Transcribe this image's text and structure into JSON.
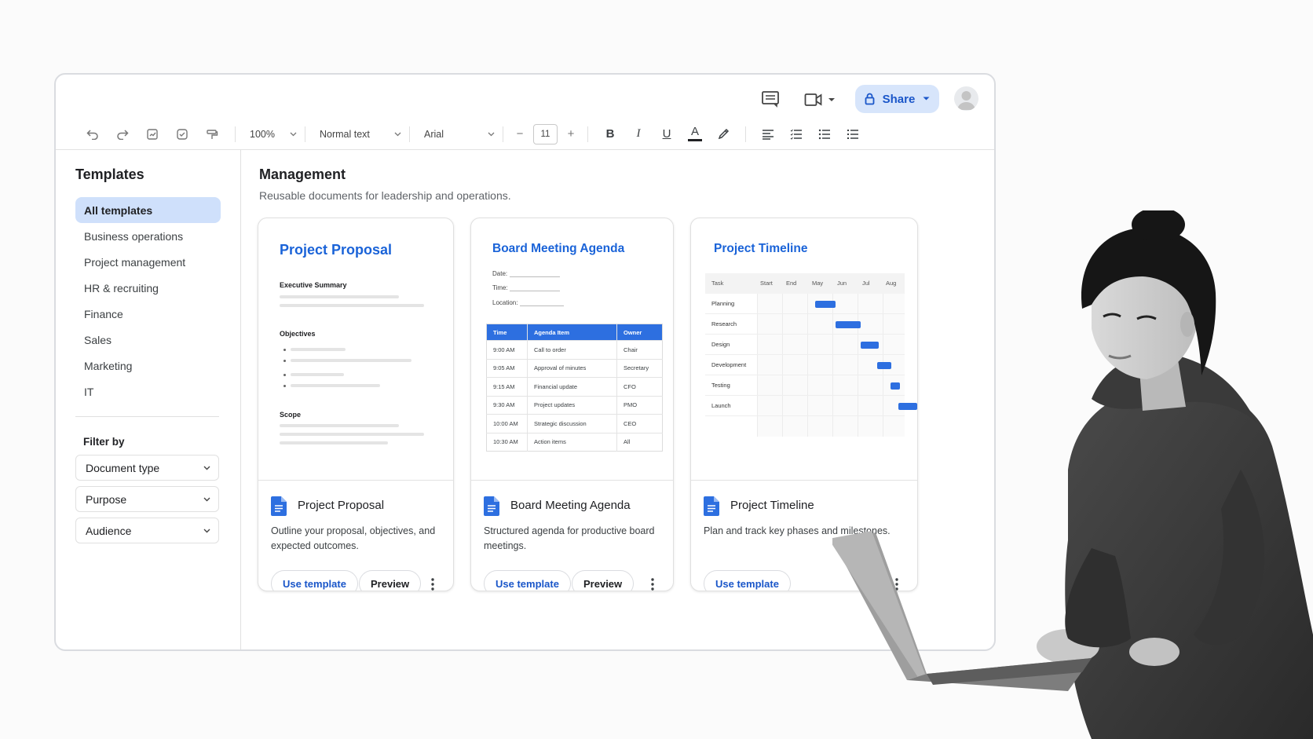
{
  "toolbar": {
    "zoom": "100%",
    "style": "Normal text",
    "font": "Arial",
    "font_size": "11",
    "minus": "−",
    "plus": "+",
    "bold": "B",
    "italic": "I",
    "underline": "U",
    "text_color": "A"
  },
  "header": {
    "share_label": "Share"
  },
  "sidebar": {
    "title": "Templates",
    "items": [
      {
        "label": "All templates",
        "active": true
      },
      {
        "label": "Business operations"
      },
      {
        "label": "Project management"
      },
      {
        "label": "HR & recruiting"
      },
      {
        "label": "Finance"
      },
      {
        "label": "Sales"
      },
      {
        "label": "Marketing"
      },
      {
        "label": "IT"
      }
    ],
    "filter_title": "Filter by",
    "filters": [
      "Document type",
      "Purpose",
      "Audience"
    ]
  },
  "main": {
    "title": "Management",
    "subtitle": "Reusable documents for leadership and operations."
  },
  "cards": [
    {
      "preview_title": "Project Proposal",
      "sections": [
        "Executive Summary",
        "Objectives",
        "Scope"
      ],
      "name": "Project Proposal",
      "desc_line1": "Outline your proposal, objectives, and",
      "desc_line2": "expected outcomes.",
      "use_label": "Use template",
      "preview_label": "Preview"
    },
    {
      "preview_title": "Board Meeting Agenda",
      "fields": [
        "Date:",
        "Time:",
        "Location:"
      ],
      "table_headers": [
        "Time",
        "Agenda Item",
        "Owner"
      ],
      "table_rows": [
        [
          "9:00 AM",
          "Call to order",
          "Chair"
        ],
        [
          "9:05 AM",
          "Approval of minutes",
          "Secretary"
        ],
        [
          "9:15 AM",
          "Financial update",
          "CFO"
        ],
        [
          "9:30 AM",
          "Project updates",
          "PMO"
        ],
        [
          "10:00 AM",
          "Strategic discussion",
          "CEO"
        ],
        [
          "10:30 AM",
          "Action items",
          "All"
        ]
      ],
      "name": "Board Meeting Agenda",
      "desc_line1": "Structured agenda for productive board",
      "desc_line2": "meetings.",
      "use_label": "Use template",
      "preview_label": "Preview"
    },
    {
      "preview_title": "Project Timeline",
      "columns": [
        "Task",
        "Start",
        "End",
        "May",
        "Jun",
        "Jul",
        "Aug"
      ],
      "tasks": [
        "Planning",
        "Research",
        "Design",
        "Development",
        "Testing",
        "Launch"
      ],
      "name": "Project Timeline",
      "desc_line1": "Plan and track key phases and milestones.",
      "use_label": "Use template"
    }
  ],
  "colors": {
    "accent": "#1a63d8",
    "share_bg": "#d7e5fb",
    "active_nav": "#cfe0fb"
  }
}
